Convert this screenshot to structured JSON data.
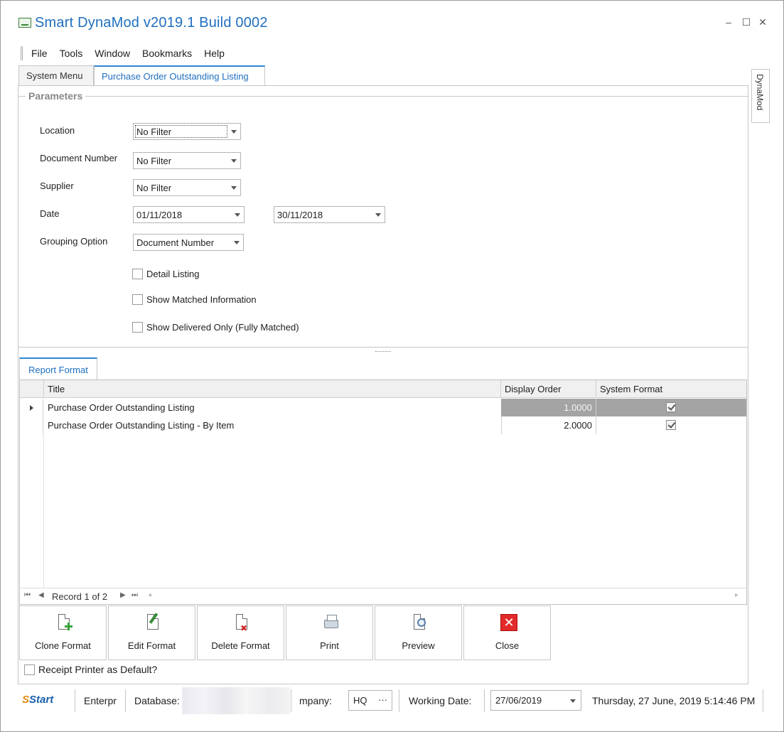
{
  "window": {
    "title": "Smart DynaMod v2019.1 Build 0002",
    "controls": {
      "minimize": "–",
      "maximize": "☐",
      "close": "✕"
    }
  },
  "menu": [
    "File",
    "Tools",
    "Window",
    "Bookmarks",
    "Help"
  ],
  "tabs": [
    {
      "label": "System Menu",
      "active": false
    },
    {
      "label": "Purchase Order Outstanding Listing",
      "active": true
    }
  ],
  "side_tab": "DynaMod",
  "parameters": {
    "group_label": "Parameters",
    "location": {
      "label": "Location",
      "value": "No Filter"
    },
    "document_number": {
      "label": "Document Number",
      "value": "No Filter"
    },
    "supplier": {
      "label": "Supplier",
      "value": "No Filter"
    },
    "date": {
      "label": "Date",
      "from": "01/11/2018",
      "to": "30/11/2018"
    },
    "grouping": {
      "label": "Grouping Option",
      "value": "Document Number"
    },
    "checkboxes": [
      {
        "label": "Detail Listing",
        "checked": false
      },
      {
        "label": "Show Matched Information",
        "checked": false
      },
      {
        "label": "Show Delivered Only (Fully Matched)",
        "checked": false
      }
    ]
  },
  "report_format": {
    "tab_label": "Report Format",
    "columns": [
      "Title",
      "Display Order",
      "System Format"
    ],
    "rows": [
      {
        "title": "Purchase Order Outstanding Listing",
        "display_order": "1.0000",
        "system_format": true,
        "selected": true
      },
      {
        "title": "Purchase Order Outstanding Listing - By Item",
        "display_order": "2.0000",
        "system_format": true,
        "selected": false
      }
    ],
    "navigator": {
      "text": "Record 1 of 2"
    }
  },
  "actions": [
    {
      "label": "Clone Format",
      "icon": "clone-format-icon"
    },
    {
      "label": "Edit Format",
      "icon": "edit-format-icon"
    },
    {
      "label": "Delete Format",
      "icon": "delete-format-icon"
    },
    {
      "label": "Print",
      "icon": "printer-icon"
    },
    {
      "label": "Preview",
      "icon": "preview-icon"
    },
    {
      "label": "Close",
      "icon": "close-icon"
    }
  ],
  "receipt_printer": {
    "label": "Receipt Printer as Default?",
    "checked": false
  },
  "statusbar": {
    "logo": "Start",
    "edition": "Enterpr",
    "database_label": "Database:",
    "company_label": "mpany:",
    "company_value": "HQ",
    "company_button": "···",
    "working_date_label": "Working Date:",
    "working_date": "27/06/2019",
    "datetime": "Thursday, 27 June, 2019 5:14:46 PM"
  },
  "colors": {
    "accent": "#1f6fbf",
    "tab_border": "#2f86d0",
    "selected_row": "#a4a4a4"
  }
}
